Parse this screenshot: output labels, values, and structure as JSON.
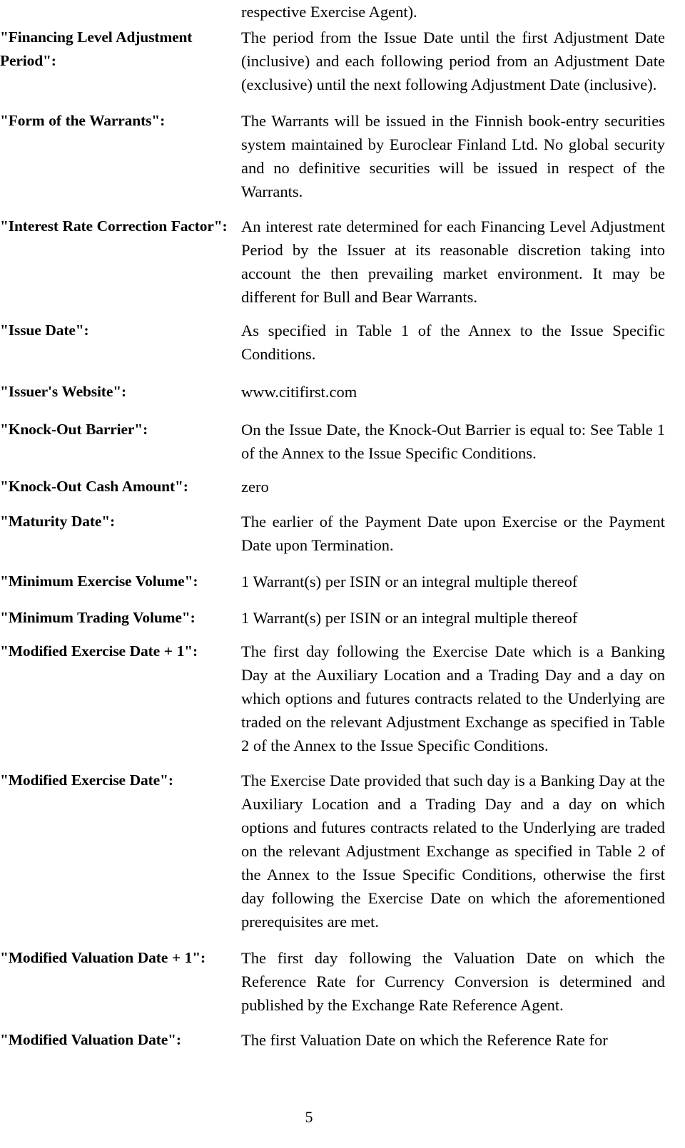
{
  "document": {
    "page_number": "5",
    "continuation_line": "respective Exercise Agent).",
    "definitions": [
      {
        "term": "\"Financing Level Adjustment Period\":",
        "definition": "The period from the Issue Date until the first Adjustment Date (inclusive) and each following period from an Adjustment Date (exclusive) until the next following Adjustment Date (inclusive).",
        "justify": true
      },
      {
        "term": "\"Form of the Warrants\":",
        "definition": "The Warrants will be issued in the Finnish book-entry securities system maintained by Euroclear Finland Ltd. No global security and no definitive securities will be issued in respect of the Warrants.",
        "justify": true
      },
      {
        "term": "\"Interest Rate Correction Factor\":",
        "definition": "An interest rate determined for each Financing Level Adjustment Period by the Issuer at its reasonable discretion taking into account the then prevailing market environment. It may be different for Bull and Bear Warrants.",
        "justify": true
      },
      {
        "term": "\"Issue Date\":",
        "definition": "As specified in Table 1 of the Annex to the Issue Specific Conditions.",
        "justify": true
      },
      {
        "term": "\"Issuer's Website\":",
        "definition": "www.citifirst.com",
        "justify": false
      },
      {
        "term": "\"Knock-Out Barrier\":",
        "definition": "On the Issue Date, the Knock-Out Barrier is equal to: See Table 1 of the Annex to the Issue Specific Conditions.",
        "justify": true
      },
      {
        "term": "\"Knock-Out Cash Amount\":",
        "definition": "zero",
        "justify": false
      },
      {
        "term": "\"Maturity Date\":",
        "definition": "The earlier of the Payment Date upon Exercise or the Payment Date upon Termination.",
        "justify": true
      },
      {
        "term": "\"Minimum Exercise Volume\":",
        "definition": "1 Warrant(s) per ISIN or an integral multiple thereof",
        "justify": false
      },
      {
        "term": "\"Minimum Trading Volume\":",
        "definition": "1 Warrant(s) per ISIN or an integral multiple thereof",
        "justify": false
      },
      {
        "term": "\"Modified Exercise Date + 1\":",
        "definition": "The first day following the Exercise Date which is a Banking Day at the Auxiliary Location and a Trading Day and a day on which options and futures contracts related to the Underlying are traded on the relevant Adjustment Exchange as specified in Table 2 of the Annex to the Issue Specific Conditions.",
        "justify": true
      },
      {
        "term": "\"Modified Exercise Date\":",
        "definition": "The Exercise Date provided that such day is a Banking Day at the Auxiliary Location and a Trading Day and a day on which options and futures contracts related to the Underlying are traded on the relevant Adjustment Exchange as specified in Table 2 of the Annex to the Issue Specific Conditions, otherwise the first day following the Exercise Date on which the aforementioned prerequisites are met.",
        "justify": true
      },
      {
        "term": "\"Modified Valuation Date + 1\":",
        "definition": "The first day following the Valuation Date on which the Reference Rate for Currency Conversion is determined and published by the Exchange Rate Reference Agent.",
        "justify": true
      },
      {
        "term": "\"Modified Valuation Date\":",
        "definition": "The first Valuation Date on which the Reference Rate for",
        "justify": true
      }
    ]
  }
}
